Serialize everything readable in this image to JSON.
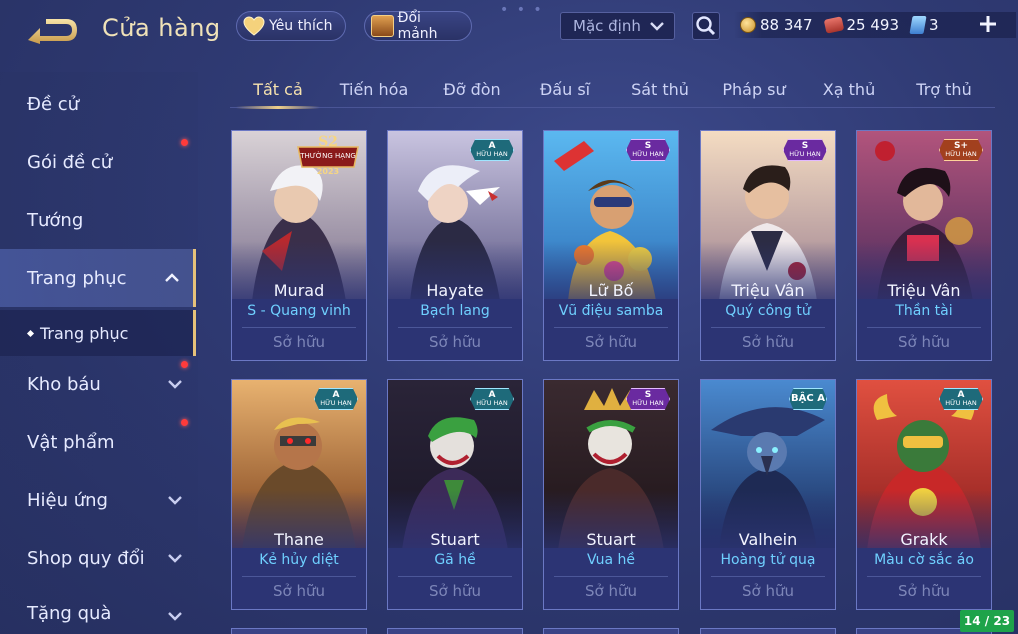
{
  "header": {
    "title": "Cửa hàng",
    "favorites_label": "Yêu thích",
    "fragments_label": "Đổi mảnh",
    "sort_value": "Mặc định"
  },
  "currencies": {
    "gold": "88 347",
    "vouchers": "25 493",
    "tickets": "3"
  },
  "sidebar": {
    "items": [
      {
        "label": "Đề cử"
      },
      {
        "label": "Gói đề cử"
      },
      {
        "label": "Tướng"
      },
      {
        "label": "Trang phục"
      },
      {
        "label": "Kho báu"
      },
      {
        "label": "Vật phẩm"
      },
      {
        "label": "Hiệu ứng"
      },
      {
        "label": "Shop quy đổi"
      },
      {
        "label": "Tặng quà"
      }
    ],
    "sub_item": "Trang phục"
  },
  "tabs": [
    "Tất cả",
    "Tiến hóa",
    "Đỡ đòn",
    "Đấu sĩ",
    "Sát thủ",
    "Pháp sư",
    "Xạ thủ",
    "Trợ thủ"
  ],
  "cards": [
    {
      "hero": "Murad",
      "skin": "S - Quang vinh",
      "status": "Sở hữu",
      "badge": "S2 THƯỜNG HẠNG 2023"
    },
    {
      "hero": "Hayate",
      "skin": "Bạch lang",
      "status": "Sở hữu",
      "badge_grade": "A",
      "badge_label": "HỮU HẠN"
    },
    {
      "hero": "Lữ Bố",
      "skin": "Vũ điệu samba",
      "status": "Sở hữu",
      "badge_grade": "S",
      "badge_label": "HỮU HẠN"
    },
    {
      "hero": "Triệu Vân",
      "skin": "Quý công tử",
      "status": "Sở hữu",
      "badge_grade": "S",
      "badge_label": "HỮU HẠN"
    },
    {
      "hero": "Triệu Vân",
      "skin": "Thần tài",
      "status": "Sở hữu",
      "badge_grade": "S+",
      "badge_label": "HỮU HẠN"
    },
    {
      "hero": "Thane",
      "skin": "Kẻ hủy diệt",
      "status": "Sở hữu",
      "badge_grade": "A",
      "badge_label": "HỮU HẠN"
    },
    {
      "hero": "Stuart",
      "skin": "Gã hề",
      "status": "Sở hữu",
      "badge_grade": "A",
      "badge_label": "HỮU HẠN"
    },
    {
      "hero": "Stuart",
      "skin": "Vua hề",
      "status": "Sở hữu",
      "badge_grade": "S",
      "badge_label": "HỮU HẠN"
    },
    {
      "hero": "Valhein",
      "skin": "Hoàng tử quạ",
      "status": "Sở hữu",
      "badge_grade": "BẬC A",
      "badge_label": ""
    },
    {
      "hero": "Grakk",
      "skin": "Màu cờ sắc áo",
      "status": "Sở hữu",
      "badge_grade": "A",
      "badge_label": "HỮU HẠN"
    }
  ],
  "pager": "14 / 23",
  "colors": {
    "accent_gold": "#f0d08a",
    "skin_name": "#6fd0ff",
    "notification": "#ff3b3b",
    "pager_bg": "#1ea34a"
  }
}
